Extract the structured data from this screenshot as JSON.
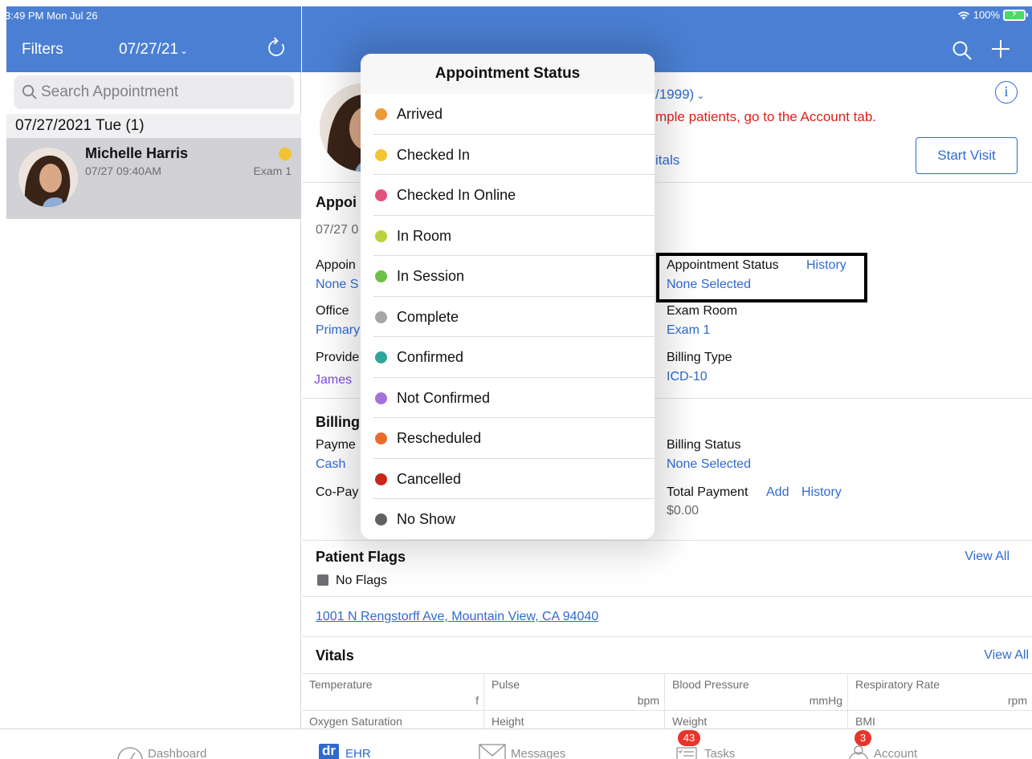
{
  "status_bar": {
    "time": "3:49 PM  Mon Jul 26",
    "battery": "100%"
  },
  "left_header": {
    "filters": "Filters",
    "date": "07/27/21"
  },
  "search": {
    "placeholder": "Search Appointment"
  },
  "date_group": {
    "header": "07/27/2021 Tue (1)"
  },
  "appointment": {
    "name": "Michelle Harris",
    "time": "07/27 09:40AM",
    "room": "Exam 1",
    "status_color": "#f3c430"
  },
  "patient": {
    "dob_partial": "/1999)",
    "warning": "mple patients, go to the Account tab.",
    "vitals_link": "itals",
    "start_visit": "Start Visit"
  },
  "appointment_section": {
    "title": "Appoi",
    "datetime": "07/27 0",
    "type_label": "Appoin",
    "type_value": "None S",
    "office_label": "Office",
    "office_value": "Primary",
    "provider_label": "Provide",
    "provider_value": "James",
    "status_label": "Appointment Status",
    "status_history": "History",
    "status_value": "None Selected",
    "exam_room_label": "Exam Room",
    "exam_room_value": "Exam 1",
    "billing_type_label": "Billing Type",
    "billing_type_value": "ICD-10"
  },
  "billing_section": {
    "title": "Billing",
    "payment_label": "Payme",
    "payment_value": "Cash",
    "copay_label": "Co-Pay",
    "billing_status_label": "Billing Status",
    "billing_status_value": "None Selected",
    "total_payment_label": "Total Payment",
    "add": "Add",
    "history": "History",
    "total_payment_value": "$0.00"
  },
  "flags": {
    "title": "Patient Flags",
    "view_all": "View All",
    "no_flags": "No Flags"
  },
  "address": "1001 N Rengstorff Ave, Mountain View, CA 94040",
  "vitals": {
    "title": "Vitals",
    "view_all": "View All",
    "row1": [
      {
        "name": "Temperature",
        "unit": "f"
      },
      {
        "name": "Pulse",
        "unit": "bpm"
      },
      {
        "name": "Blood Pressure",
        "unit": "mmHg"
      },
      {
        "name": "Respiratory Rate",
        "unit": "rpm"
      }
    ],
    "row2": [
      {
        "name": "Oxygen Saturation"
      },
      {
        "name": "Height"
      },
      {
        "name": "Weight"
      },
      {
        "name": "BMI"
      }
    ]
  },
  "popover": {
    "title": "Appointment Status",
    "items": [
      {
        "label": "Arrived",
        "color": "#ee9a3a"
      },
      {
        "label": "Checked In",
        "color": "#f3c430"
      },
      {
        "label": "Checked In Online",
        "color": "#e2527f"
      },
      {
        "label": "In Room",
        "color": "#b8d33b"
      },
      {
        "label": "In Session",
        "color": "#6cc04a"
      },
      {
        "label": "Complete",
        "color": "#a6a6a6"
      },
      {
        "label": "Confirmed",
        "color": "#2fa59a"
      },
      {
        "label": "Not Confirmed",
        "color": "#a372d9"
      },
      {
        "label": "Rescheduled",
        "color": "#ea6a2c"
      },
      {
        "label": "Cancelled",
        "color": "#c8261d"
      },
      {
        "label": "No Show",
        "color": "#616161"
      }
    ]
  },
  "tabs": {
    "dashboard": "Dashboard",
    "ehr": "EHR",
    "ehr_logo": "dr",
    "messages": "Messages",
    "tasks": "Tasks",
    "tasks_badge": "43",
    "account": "Account",
    "account_badge": "3"
  },
  "colors": {
    "header": "#4a7fd3",
    "link": "#2f6ad0",
    "warning": "#e0201a",
    "selected_row": "#d1d1d6"
  }
}
